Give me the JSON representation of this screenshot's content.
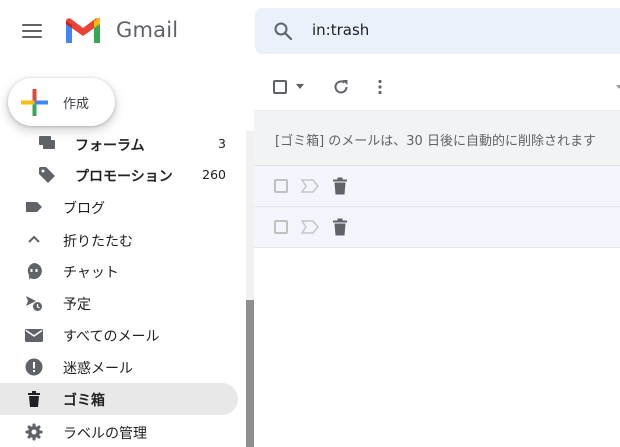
{
  "header": {
    "brand": "Gmail",
    "search_value": "in:trash"
  },
  "compose": {
    "label": "作成"
  },
  "sidebar": {
    "items": [
      {
        "label": "フォーラム",
        "count": "3",
        "icon": "forum-icon"
      },
      {
        "label": "プロモーション",
        "count": "260",
        "icon": "label-tag-icon"
      },
      {
        "label": "ブログ",
        "count": "",
        "icon": "label-icon"
      },
      {
        "label": "折りたたむ",
        "count": "",
        "icon": "chevron-up-icon"
      },
      {
        "label": "チャット",
        "count": "",
        "icon": "chat-icon"
      },
      {
        "label": "予定",
        "count": "",
        "icon": "scheduled-icon"
      },
      {
        "label": "すべてのメール",
        "count": "",
        "icon": "mail-icon"
      },
      {
        "label": "迷惑メール",
        "count": "",
        "icon": "spam-icon"
      },
      {
        "label": "ゴミ箱",
        "count": "",
        "icon": "trash-icon",
        "active": true
      },
      {
        "label": "ラベルの管理",
        "count": "",
        "icon": "gear-icon"
      }
    ]
  },
  "main": {
    "banner_text": "[ゴミ箱] のメールは、30 日後に自動的に削除されます",
    "rows": [
      {},
      {}
    ]
  },
  "colors": {
    "active_bg": "#e8e8e8",
    "search_bg": "#eaf1fb",
    "icon_grey": "#5f6368"
  }
}
